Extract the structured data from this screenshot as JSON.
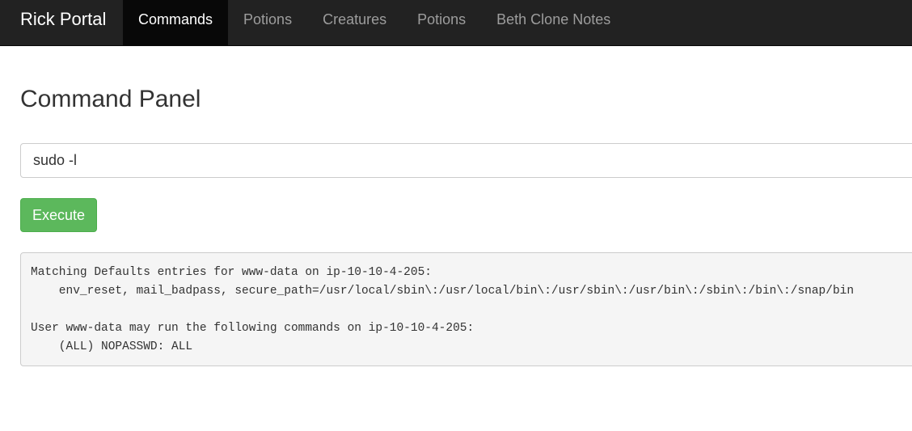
{
  "navbar": {
    "brand": "Rick Portal",
    "items": [
      {
        "label": "Commands",
        "active": true
      },
      {
        "label": "Potions"
      },
      {
        "label": "Creatures"
      },
      {
        "label": "Potions"
      },
      {
        "label": "Beth Clone Notes"
      }
    ]
  },
  "main": {
    "title": "Command Panel",
    "command_value": "sudo -l",
    "execute_label": "Execute",
    "output": "Matching Defaults entries for www-data on ip-10-10-4-205:\n    env_reset, mail_badpass, secure_path=/usr/local/sbin\\:/usr/local/bin\\:/usr/sbin\\:/usr/bin\\:/sbin\\:/bin\\:/snap/bin\n\nUser www-data may run the following commands on ip-10-10-4-205:\n    (ALL) NOPASSWD: ALL"
  },
  "colors": {
    "navbar_bg": "#222222",
    "execute_button": "#5cb85c",
    "output_bg": "#f5f5f5"
  }
}
